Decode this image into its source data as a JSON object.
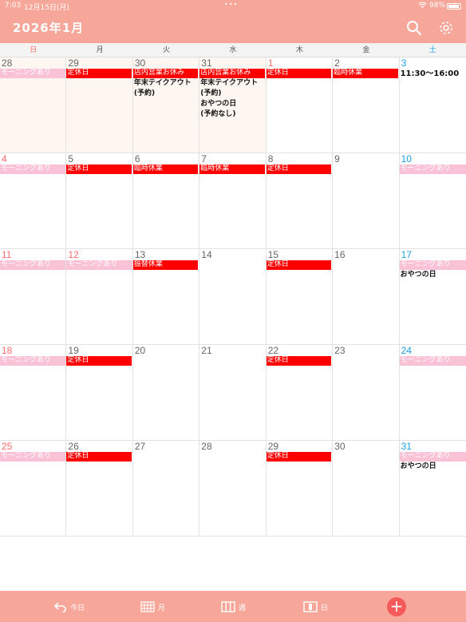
{
  "status": {
    "time": "7:03",
    "date": "12月15日(月)",
    "battery": "98%"
  },
  "header": {
    "title": "2026年1月"
  },
  "weekdays": [
    "日",
    "月",
    "火",
    "水",
    "木",
    "金",
    "土"
  ],
  "weeks": [
    [
      {
        "day": "28",
        "prev": true,
        "events": [
          {
            "text": "モーニングあり",
            "type": "morning"
          }
        ]
      },
      {
        "day": "29",
        "prev": true,
        "events": [
          {
            "text": "定休日",
            "type": "holiday"
          }
        ]
      },
      {
        "day": "30",
        "prev": true,
        "events": [
          {
            "text": "店内営業お休み",
            "type": "holiday"
          },
          {
            "text": "年末テイクアウト",
            "type": "plain"
          },
          {
            "text": "(予約)",
            "type": "plain"
          }
        ]
      },
      {
        "day": "31",
        "prev": true,
        "events": [
          {
            "text": "店内営業お休み",
            "type": "holiday"
          },
          {
            "text": "年末テイクアウト",
            "type": "plain"
          },
          {
            "text": "(予約)",
            "type": "plain"
          },
          {
            "text": "おやつの日",
            "type": "plain"
          },
          {
            "text": "(予約なし)",
            "type": "plain"
          }
        ]
      },
      {
        "day": "1",
        "numClass": "sun",
        "events": [
          {
            "text": "定休日",
            "type": "holiday"
          }
        ]
      },
      {
        "day": "2",
        "events": [
          {
            "text": "臨時休業",
            "type": "holiday"
          }
        ]
      },
      {
        "day": "3",
        "numClass": "sat",
        "events": [
          {
            "text": "11:30〜16:00",
            "type": "plain time"
          }
        ]
      }
    ],
    [
      {
        "day": "4",
        "numClass": "sun",
        "events": [
          {
            "text": "モーニングあり",
            "type": "morning"
          }
        ]
      },
      {
        "day": "5",
        "events": [
          {
            "text": "定休日",
            "type": "holiday"
          }
        ]
      },
      {
        "day": "6",
        "events": [
          {
            "text": "臨時休業",
            "type": "holiday"
          }
        ]
      },
      {
        "day": "7",
        "events": [
          {
            "text": "臨時休業",
            "type": "holiday"
          }
        ]
      },
      {
        "day": "8",
        "events": [
          {
            "text": "定休日",
            "type": "holiday"
          }
        ]
      },
      {
        "day": "9",
        "events": []
      },
      {
        "day": "10",
        "numClass": "sat",
        "events": [
          {
            "text": "モーニングあり",
            "type": "morning"
          }
        ]
      }
    ],
    [
      {
        "day": "11",
        "numClass": "sun",
        "events": [
          {
            "text": "モーニングあり",
            "type": "morning"
          }
        ]
      },
      {
        "day": "12",
        "numClass": "sun",
        "events": [
          {
            "text": "モーニングあり",
            "type": "morning"
          }
        ]
      },
      {
        "day": "13",
        "events": [
          {
            "text": "振替休業",
            "type": "holiday"
          }
        ]
      },
      {
        "day": "14",
        "events": []
      },
      {
        "day": "15",
        "events": [
          {
            "text": "定休日",
            "type": "holiday"
          }
        ]
      },
      {
        "day": "16",
        "events": []
      },
      {
        "day": "17",
        "numClass": "sat",
        "events": [
          {
            "text": "モーニングあり",
            "type": "morning"
          },
          {
            "text": "おやつの日",
            "type": "plain"
          }
        ]
      }
    ],
    [
      {
        "day": "18",
        "numClass": "sun",
        "events": [
          {
            "text": "モーニングあり",
            "type": "morning"
          }
        ]
      },
      {
        "day": "19",
        "events": [
          {
            "text": "定休日",
            "type": "holiday"
          }
        ]
      },
      {
        "day": "20",
        "events": []
      },
      {
        "day": "21",
        "events": []
      },
      {
        "day": "22",
        "events": [
          {
            "text": "定休日",
            "type": "holiday"
          }
        ]
      },
      {
        "day": "23",
        "events": []
      },
      {
        "day": "24",
        "numClass": "sat",
        "events": [
          {
            "text": "モーニングあり",
            "type": "morning"
          }
        ]
      }
    ],
    [
      {
        "day": "25",
        "numClass": "sun",
        "events": [
          {
            "text": "モーニングあり",
            "type": "morning"
          }
        ]
      },
      {
        "day": "26",
        "events": [
          {
            "text": "定休日",
            "type": "holiday"
          }
        ]
      },
      {
        "day": "27",
        "events": []
      },
      {
        "day": "28",
        "events": []
      },
      {
        "day": "29",
        "events": [
          {
            "text": "定休日",
            "type": "holiday"
          }
        ]
      },
      {
        "day": "30",
        "events": []
      },
      {
        "day": "31",
        "numClass": "sat",
        "events": [
          {
            "text": "モーニングあり",
            "type": "morning"
          },
          {
            "text": "おやつの日",
            "type": "plain"
          }
        ]
      }
    ]
  ],
  "toolbar": {
    "today": "今日",
    "month": "月",
    "week": "週",
    "day": "日",
    "add": "+"
  },
  "colors": {
    "accent": "#f6a79a",
    "holiday": "#ff0000",
    "morning": "#f9c2d6",
    "sunday": "#ff6b6b",
    "saturday": "#1ea0e8",
    "add": "#f45a5a"
  },
  "icons": {
    "search": "search-icon",
    "settings": "gear-icon",
    "today": "undo-arrow-icon",
    "month": "month-grid-icon",
    "week": "week-columns-icon",
    "day": "day-view-icon",
    "add": "plus-icon"
  }
}
